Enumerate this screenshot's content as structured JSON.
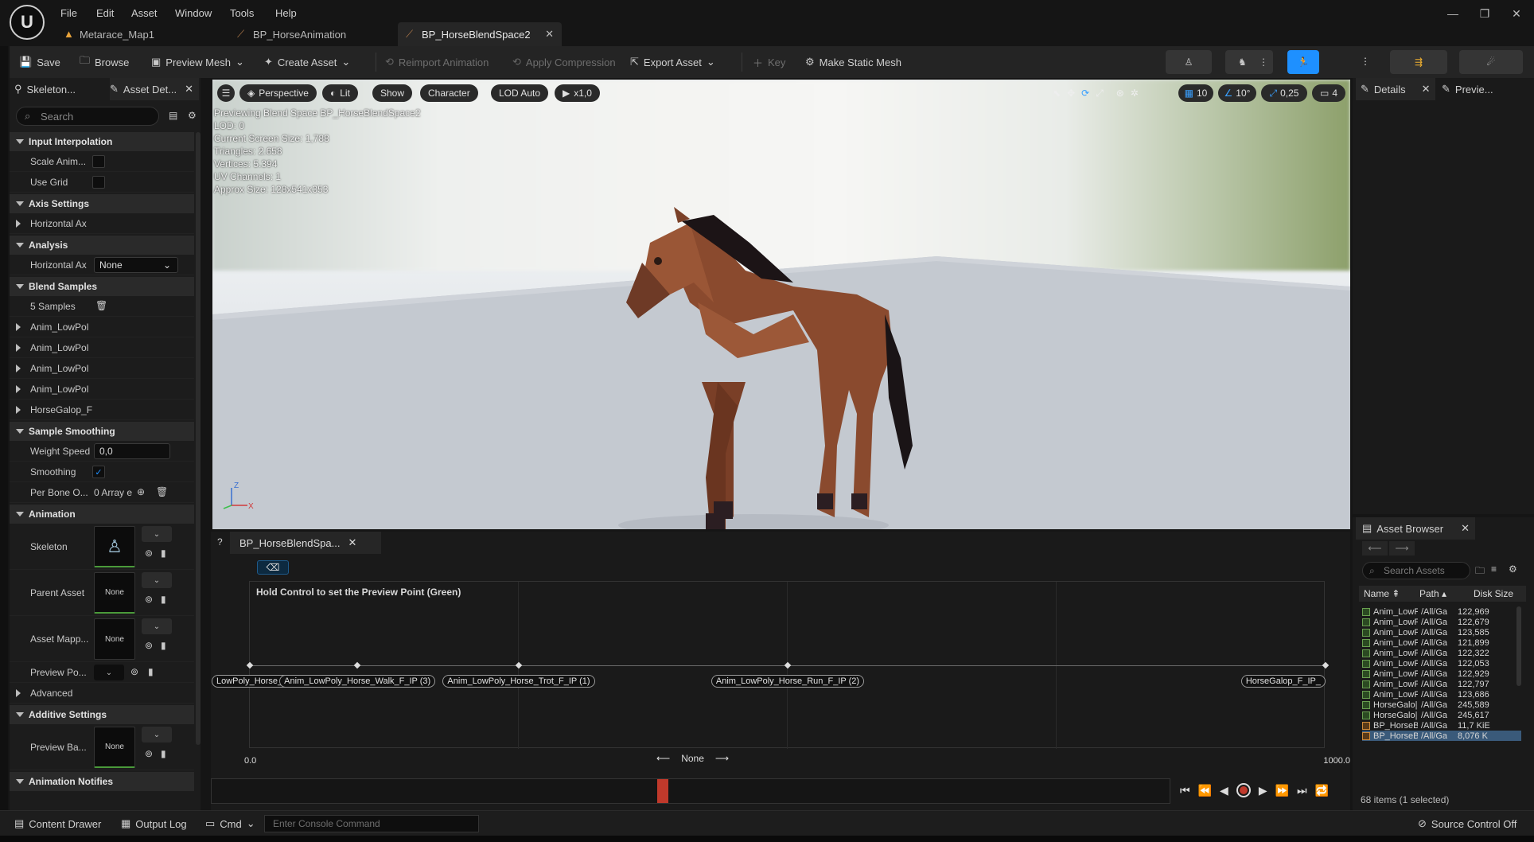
{
  "menu": [
    "File",
    "Edit",
    "Asset",
    "Window",
    "Tools",
    "Help"
  ],
  "doc_tabs": [
    {
      "label": "Metarace_Map1"
    },
    {
      "label": "BP_HorseAnimation"
    },
    {
      "label": "BP_HorseBlendSpace2"
    }
  ],
  "toolbar": {
    "save": "Save",
    "browse": "Browse",
    "preview_mesh": "Preview Mesh",
    "create_asset": "Create Asset",
    "reimport": "Reimport Animation",
    "apply_compression": "Apply Compression",
    "export_asset": "Export Asset",
    "key": "Key",
    "make_static_mesh": "Make Static Mesh"
  },
  "left_panel": {
    "tab_skeleton": "Skeleton...",
    "tab_asset_details": "Asset Det...",
    "search_placeholder": "Search",
    "sections": {
      "input_interpolation": "Input Interpolation",
      "axis_settings": "Axis Settings",
      "analysis": "Analysis",
      "blend_samples": "Blend Samples",
      "sample_smoothing": "Sample Smoothing",
      "animation": "Animation",
      "additive_settings": "Additive Settings",
      "animation_notifies": "Animation Notifies"
    },
    "props": {
      "scale_anim": "Scale Anim...",
      "use_grid": "Use Grid",
      "horizontal_axis": "Horizontal Ax",
      "analysis_horizontal": "Horizontal Ax",
      "analysis_value": "None",
      "samples_count": "5 Samples",
      "sample1": "Anim_LowPol",
      "sample2": "Anim_LowPol",
      "sample3": "Anim_LowPol",
      "sample4": "Anim_LowPol",
      "sample5": "HorseGalop_F",
      "weight_speed": "Weight Speed",
      "weight_speed_value": "0,0",
      "smoothing": "Smoothing",
      "per_bone": "Per Bone O...",
      "per_bone_value": "0 Array e",
      "skeleton": "Skeleton",
      "parent_asset": "Parent Asset",
      "parent_asset_value": "None",
      "asset_mapping": "Asset Mapp...",
      "asset_mapping_value": "None",
      "preview_pose": "Preview Po...",
      "advanced": "Advanced",
      "preview_base": "Preview Ba...",
      "preview_base_value": "None"
    }
  },
  "viewport": {
    "perspective": "Perspective",
    "lit": "Lit",
    "show": "Show",
    "character": "Character",
    "lod": "LOD Auto",
    "speed": "x1,0",
    "grid_snap": "10",
    "rot_snap": "10°",
    "scale_snap": "0,25",
    "cam_speed": "4",
    "info": [
      "Previewing Blend Space BP_HorseBlendSpace2",
      "LOD: 0",
      "Current Screen Size: 1,788",
      "Triangles: 2.658",
      "Vertices: 5.394",
      "UV Channels: 1",
      "Approx Size: 128x541x353"
    ],
    "axis_z": "Z",
    "axis_x": "X"
  },
  "right_panel": {
    "details": "Details",
    "preview": "Previe..."
  },
  "blendspace": {
    "tab": "BP_HorseBlendSpa...",
    "hint": "Hold Control to set the Preview Point (Green)",
    "samples": [
      {
        "label": "LowPoly_Horse_Idle_IP (0)",
        "pos": 0.0
      },
      {
        "label": "Anim_LowPoly_Horse_Walk_F_IP (3)",
        "pos": 0.1
      },
      {
        "label": "Anim_LowPoly_Horse_Trot_F_IP (1)",
        "pos": 0.25
      },
      {
        "label": "Anim_LowPoly_Horse_Run_F_IP (2)",
        "pos": 0.5
      },
      {
        "label": "HorseGalop_F_IP_",
        "pos": 1.0
      }
    ],
    "axis_min": "0.0",
    "axis_max": "1000.0",
    "axis_name": "None",
    "timeline_position": 0.47
  },
  "asset_browser": {
    "title": "Asset Browser",
    "search_placeholder": "Search Assets",
    "col_name": "Name",
    "col_path": "Path",
    "col_size": "Disk Size",
    "rows": [
      {
        "name": "Anim_LowF",
        "path": "/All/Ga",
        "size": "122,969",
        "type": "anim"
      },
      {
        "name": "Anim_LowF",
        "path": "/All/Ga",
        "size": "122,679",
        "type": "anim"
      },
      {
        "name": "Anim_LowF",
        "path": "/All/Ga",
        "size": "123,585",
        "type": "anim"
      },
      {
        "name": "Anim_LowF",
        "path": "/All/Ga",
        "size": "121,899",
        "type": "anim"
      },
      {
        "name": "Anim_LowF",
        "path": "/All/Ga",
        "size": "122,322",
        "type": "anim"
      },
      {
        "name": "Anim_LowF",
        "path": "/All/Ga",
        "size": "122,053",
        "type": "anim"
      },
      {
        "name": "Anim_LowF",
        "path": "/All/Ga",
        "size": "122,929",
        "type": "anim"
      },
      {
        "name": "Anim_LowF",
        "path": "/All/Ga",
        "size": "122,797",
        "type": "anim"
      },
      {
        "name": "Anim_LowF",
        "path": "/All/Ga",
        "size": "123,686",
        "type": "anim"
      },
      {
        "name": "HorseGalo|",
        "path": "/All/Ga",
        "size": "245,589",
        "type": "anim"
      },
      {
        "name": "HorseGalo|",
        "path": "/All/Ga",
        "size": "245,617",
        "type": "anim"
      },
      {
        "name": "BP_HorseB",
        "path": "/All/Ga",
        "size": "11,7 KiE",
        "type": "bp"
      },
      {
        "name": "BP_HorseB",
        "path": "/All/Ga",
        "size": "8,076 K",
        "type": "bp",
        "selected": true
      }
    ],
    "status": "68 items (1 selected)"
  },
  "statusbar": {
    "content_drawer": "Content Drawer",
    "output_log": "Output Log",
    "cmd": "Cmd",
    "console_placeholder": "Enter Console Command",
    "source_control": "Source Control Off"
  },
  "colors": {
    "accent": "#1e90ff",
    "selected_row": "#3a5a7a",
    "record": "#c0392b",
    "playhead": "#c0392b"
  }
}
